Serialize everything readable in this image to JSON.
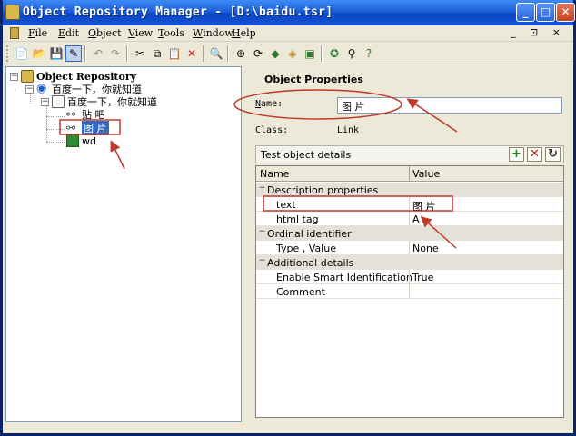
{
  "window": {
    "title": "Object Repository Manager - [D:\\baidu.tsr]"
  },
  "menubar": {
    "items": [
      "File",
      "Edit",
      "Object",
      "View",
      "Tools",
      "Window",
      "Help"
    ],
    "mdi_controls": "_ &#x25A1; x"
  },
  "toolbar": {
    "buttons": [
      "new-icon",
      "open-icon",
      "save-icon",
      "edit-icon",
      "undo-icon",
      "redo-icon",
      "cut-icon",
      "copy-icon",
      "paste-icon",
      "delete-icon",
      "find-icon",
      "add-objects-icon",
      "update-icon",
      "merge-icon",
      "export-icon",
      "highlight-icon",
      "locate-icon",
      "help-icon"
    ]
  },
  "tree": {
    "root": "Object Repository",
    "browser": "百度一下，你就知道",
    "page": "百度一下，你就知道",
    "children": [
      "贴 吧",
      "图 片",
      "wd"
    ]
  },
  "properties": {
    "header": "Object Properties",
    "name_label": "Name:",
    "name_value": "图 片",
    "class_label": "Class:",
    "class_value": "Link",
    "details_title": "Test object details",
    "col_name": "Name",
    "col_value": "Value",
    "rows": [
      {
        "type": "cat",
        "name": "Description properties"
      },
      {
        "type": "prop",
        "name": "text",
        "value": "图 片"
      },
      {
        "type": "prop",
        "name": "html tag",
        "value": "A"
      },
      {
        "type": "cat",
        "name": "Ordinal identifier"
      },
      {
        "type": "prop",
        "name": "Type , Value",
        "value": "None"
      },
      {
        "type": "cat",
        "name": "Additional details"
      },
      {
        "type": "prop",
        "name": "Enable Smart Identification",
        "value": "True"
      },
      {
        "type": "prop",
        "name": "Comment",
        "value": ""
      }
    ]
  },
  "colors": {
    "titlebar": "#1d5fd9",
    "selection": "#316ac5",
    "annotation": "#c0392b"
  }
}
